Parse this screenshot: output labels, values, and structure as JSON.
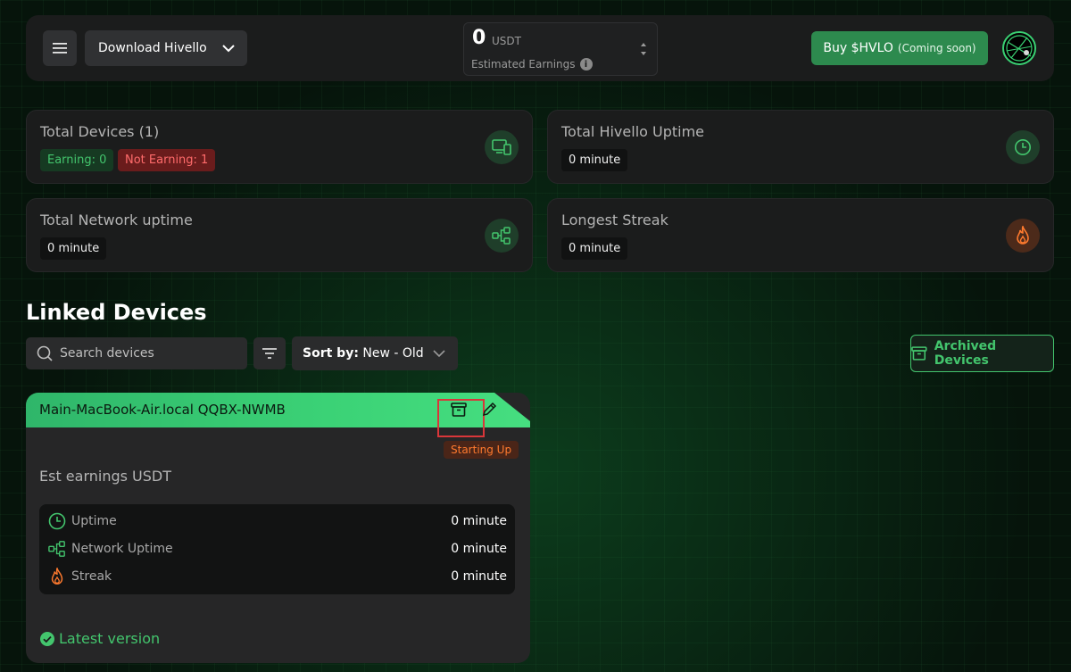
{
  "topbar": {
    "download_label": "Download Hivello",
    "earnings_value": "0",
    "earnings_unit": "USDT",
    "earnings_label": "Estimated Earnings",
    "buy_label": "Buy $HVLO",
    "buy_sub": "(Coming soon)"
  },
  "stats": {
    "total_devices": {
      "title": "Total Devices (1)",
      "earning": "Earning: 0",
      "not_earning": "Not Earning: 1"
    },
    "hivello_uptime": {
      "title": "Total Hivello Uptime",
      "value": "0 minute"
    },
    "network_uptime": {
      "title": "Total Network uptime",
      "value": "0 minute"
    },
    "longest_streak": {
      "title": "Longest Streak",
      "value": "0 minute"
    }
  },
  "linked": {
    "title": "Linked Devices",
    "search_placeholder": "Search devices",
    "sort_prefix": "Sort by:",
    "sort_value": "New - Old",
    "archived_label": "Archived Devices"
  },
  "device": {
    "name": "Main-MacBook-Air.local QQBX-NWMB",
    "status": "Starting Up",
    "est_label": "Est earnings USDT",
    "metrics": [
      {
        "label": "Uptime",
        "value": "0 minute",
        "icon": "clock-icon"
      },
      {
        "label": "Network Uptime",
        "value": "0 minute",
        "icon": "network-icon"
      },
      {
        "label": "Streak",
        "value": "0 minute",
        "icon": "flame-icon"
      }
    ],
    "version": "Latest version"
  },
  "colors": {
    "accent_green": "#43c56d",
    "buy_green": "#2d8a4e",
    "alert_red": "#ff6b6b",
    "status_orange": "#ff7a2e"
  }
}
